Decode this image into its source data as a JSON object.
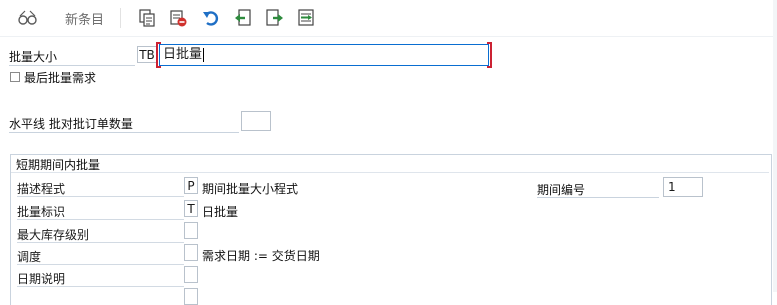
{
  "toolbar": {
    "icons": [
      "glasses-icon",
      "copy-icon",
      "delete-icon",
      "undo-icon",
      "previous-entry-icon",
      "next-entry-icon",
      "select-block-icon"
    ],
    "new_entries_label": "新条目"
  },
  "form": {
    "lot_size_label": "批量大小",
    "lot_size_code": "TB",
    "lot_size_text": "日批量",
    "last_lot_req_label": "最后批量需求",
    "horizon_label": "水平线 批对批订单数量",
    "horizon_value": ""
  },
  "group": {
    "title": "短期期间内批量",
    "rows": [
      {
        "label": "描述程式",
        "code": "P",
        "text": "期间批量大小程式"
      },
      {
        "label": "批量标识",
        "code": "T",
        "text": "日批量"
      },
      {
        "label": "最大库存级别",
        "code": "",
        "text": ""
      },
      {
        "label": "调度",
        "code": "",
        "text": "需求日期 := 交货日期"
      },
      {
        "label": "日期说明",
        "code": "",
        "text": ""
      }
    ],
    "period_number_label": "期间编号",
    "period_number_value": "1"
  }
}
